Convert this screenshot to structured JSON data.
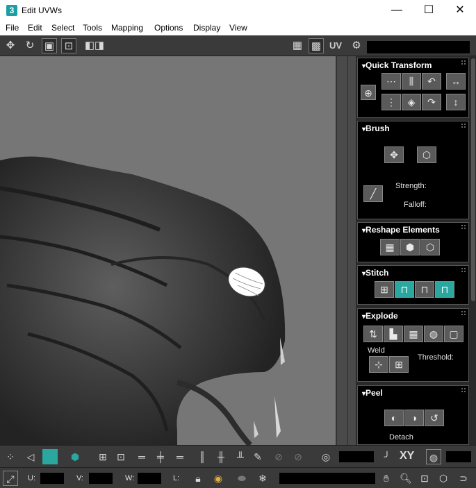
{
  "window": {
    "title": "Edit UVWs",
    "app_icon": "3",
    "minimize": "—",
    "maximize": "☐",
    "close": "✕"
  },
  "menu": [
    "File",
    "Edit",
    "Select",
    "Tools",
    "Mapping",
    "Options",
    "Display",
    "View"
  ],
  "toolbar": {
    "uv_label": "UV"
  },
  "panel": {
    "quick_transform": "Quick Transform",
    "brush": {
      "title": "Brush",
      "strength": "Strength:",
      "falloff": "Falloff:"
    },
    "reshape": "Reshape Elements",
    "stitch": "Stitch",
    "explode": {
      "title": "Explode",
      "weld": "Weld",
      "threshold": "Threshold:"
    },
    "peel": {
      "title": "Peel",
      "detach": "Detach"
    }
  },
  "status": {
    "xy_label": "XY",
    "u_label": "U:",
    "v_label": "V:",
    "w_label": "W:",
    "l_label": "L:"
  },
  "colors": {
    "accent": "#2aa8a0",
    "panel": "#000000",
    "viewport": "#767676"
  }
}
